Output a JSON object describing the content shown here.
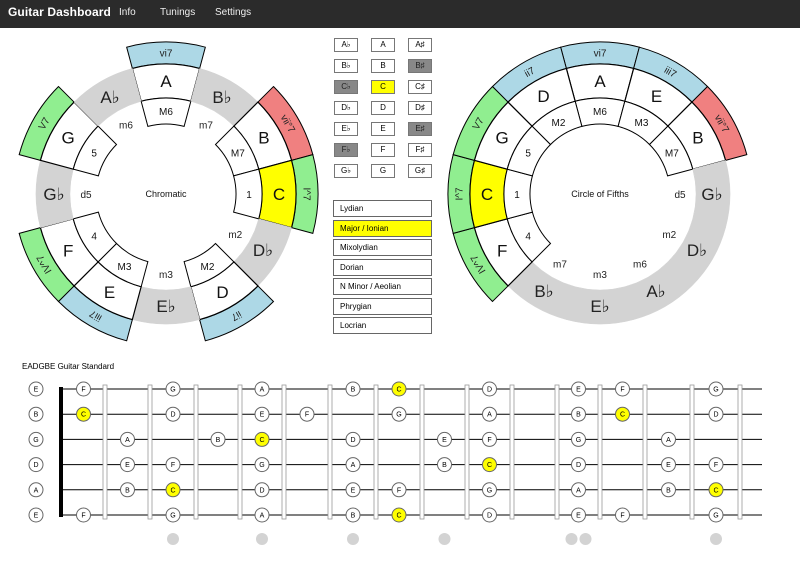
{
  "navbar": {
    "brand": "Guitar Dashboard",
    "items": [
      "Info",
      "Tunings",
      "Settings"
    ]
  },
  "colors": {
    "accent": "#ffff00",
    "triad_blue": "#add8e6",
    "dim_red": "#f08080",
    "dom_green": "#90ee90",
    "grey_ring": "#d3d3d3",
    "key_dark": "#888888"
  },
  "chromatic": {
    "center": "Chromatic",
    "notes": [
      "A",
      "B♭",
      "B",
      "C",
      "D♭",
      "D",
      "E♭",
      "E",
      "F",
      "G♭",
      "G",
      "A♭"
    ],
    "intervals": [
      "M6",
      "m7",
      "M7",
      "1",
      "m2",
      "M2",
      "m3",
      "M3",
      "4",
      "d5",
      "5",
      "m6"
    ],
    "chords": [
      "vi7",
      "",
      "vii°7",
      "I^7",
      "",
      "ii7",
      "",
      "iii7",
      "IV^7",
      "",
      "V7",
      ""
    ]
  },
  "fifths": {
    "center": "Circle of Fifths",
    "notes": [
      "A",
      "E",
      "B",
      "G♭",
      "D♭",
      "A♭",
      "E♭",
      "B♭",
      "F",
      "C",
      "G",
      "D"
    ],
    "intervals": [
      "M6",
      "M3",
      "M7",
      "d5",
      "m2",
      "m6",
      "m3",
      "m7",
      "4",
      "1",
      "5",
      "M2"
    ],
    "chords": [
      "vi7",
      "iii7",
      "vii°7",
      "",
      "",
      "",
      "",
      "",
      "IV^7",
      "I^7",
      "V7",
      "ii7"
    ]
  },
  "keys": [
    {
      "label": "A♭",
      "state": "normal"
    },
    {
      "label": "A",
      "state": "normal"
    },
    {
      "label": "A♯",
      "state": "normal"
    },
    {
      "label": "B♭",
      "state": "normal"
    },
    {
      "label": "B",
      "state": "normal"
    },
    {
      "label": "B♯",
      "state": "dark"
    },
    {
      "label": "C♭",
      "state": "dark"
    },
    {
      "label": "C",
      "state": "selected"
    },
    {
      "label": "C♯",
      "state": "normal"
    },
    {
      "label": "D♭",
      "state": "normal"
    },
    {
      "label": "D",
      "state": "normal"
    },
    {
      "label": "D♯",
      "state": "normal"
    },
    {
      "label": "E♭",
      "state": "normal"
    },
    {
      "label": "E",
      "state": "normal"
    },
    {
      "label": "E♯",
      "state": "dark"
    },
    {
      "label": "F♭",
      "state": "dark"
    },
    {
      "label": "F",
      "state": "normal"
    },
    {
      "label": "F♯",
      "state": "normal"
    },
    {
      "label": "G♭",
      "state": "normal"
    },
    {
      "label": "G",
      "state": "normal"
    },
    {
      "label": "G♯",
      "state": "normal"
    }
  ],
  "modes": [
    {
      "label": "Lydian",
      "selected": false
    },
    {
      "label": "Major / Ionian",
      "selected": true
    },
    {
      "label": "Mixolydian",
      "selected": false
    },
    {
      "label": "Dorian",
      "selected": false
    },
    {
      "label": "N Minor / Aeolian",
      "selected": false
    },
    {
      "label": "Phrygian",
      "selected": false
    },
    {
      "label": "Locrian",
      "selected": false
    }
  ],
  "fretboard": {
    "title": "EADGBE Guitar Standard",
    "strings": [
      {
        "open": "E",
        "notes": [
          "F",
          "",
          "G",
          "",
          "A",
          "",
          "B",
          "C",
          "",
          "D",
          "",
          "E",
          "F",
          "",
          "G"
        ]
      },
      {
        "open": "B",
        "notes": [
          "C",
          "",
          "D",
          "",
          "E",
          "F",
          "",
          "G",
          "",
          "A",
          "",
          "B",
          "C",
          "",
          "D"
        ]
      },
      {
        "open": "G",
        "notes": [
          "",
          "A",
          "",
          "B",
          "C",
          "",
          "D",
          "",
          "E",
          "F",
          "",
          "G",
          "",
          "A",
          ""
        ]
      },
      {
        "open": "D",
        "notes": [
          "",
          "E",
          "F",
          "",
          "G",
          "",
          "A",
          "",
          "B",
          "C",
          "",
          "D",
          "",
          "E",
          "F"
        ]
      },
      {
        "open": "A",
        "notes": [
          "",
          "B",
          "C",
          "",
          "D",
          "",
          "E",
          "F",
          "",
          "G",
          "",
          "A",
          "",
          "B",
          "C"
        ]
      },
      {
        "open": "E",
        "notes": [
          "F",
          "",
          "G",
          "",
          "A",
          "",
          "B",
          "C",
          "",
          "D",
          "",
          "E",
          "F",
          "",
          "G"
        ]
      }
    ],
    "markers": [
      3,
      5,
      7,
      9,
      12,
      15
    ]
  }
}
